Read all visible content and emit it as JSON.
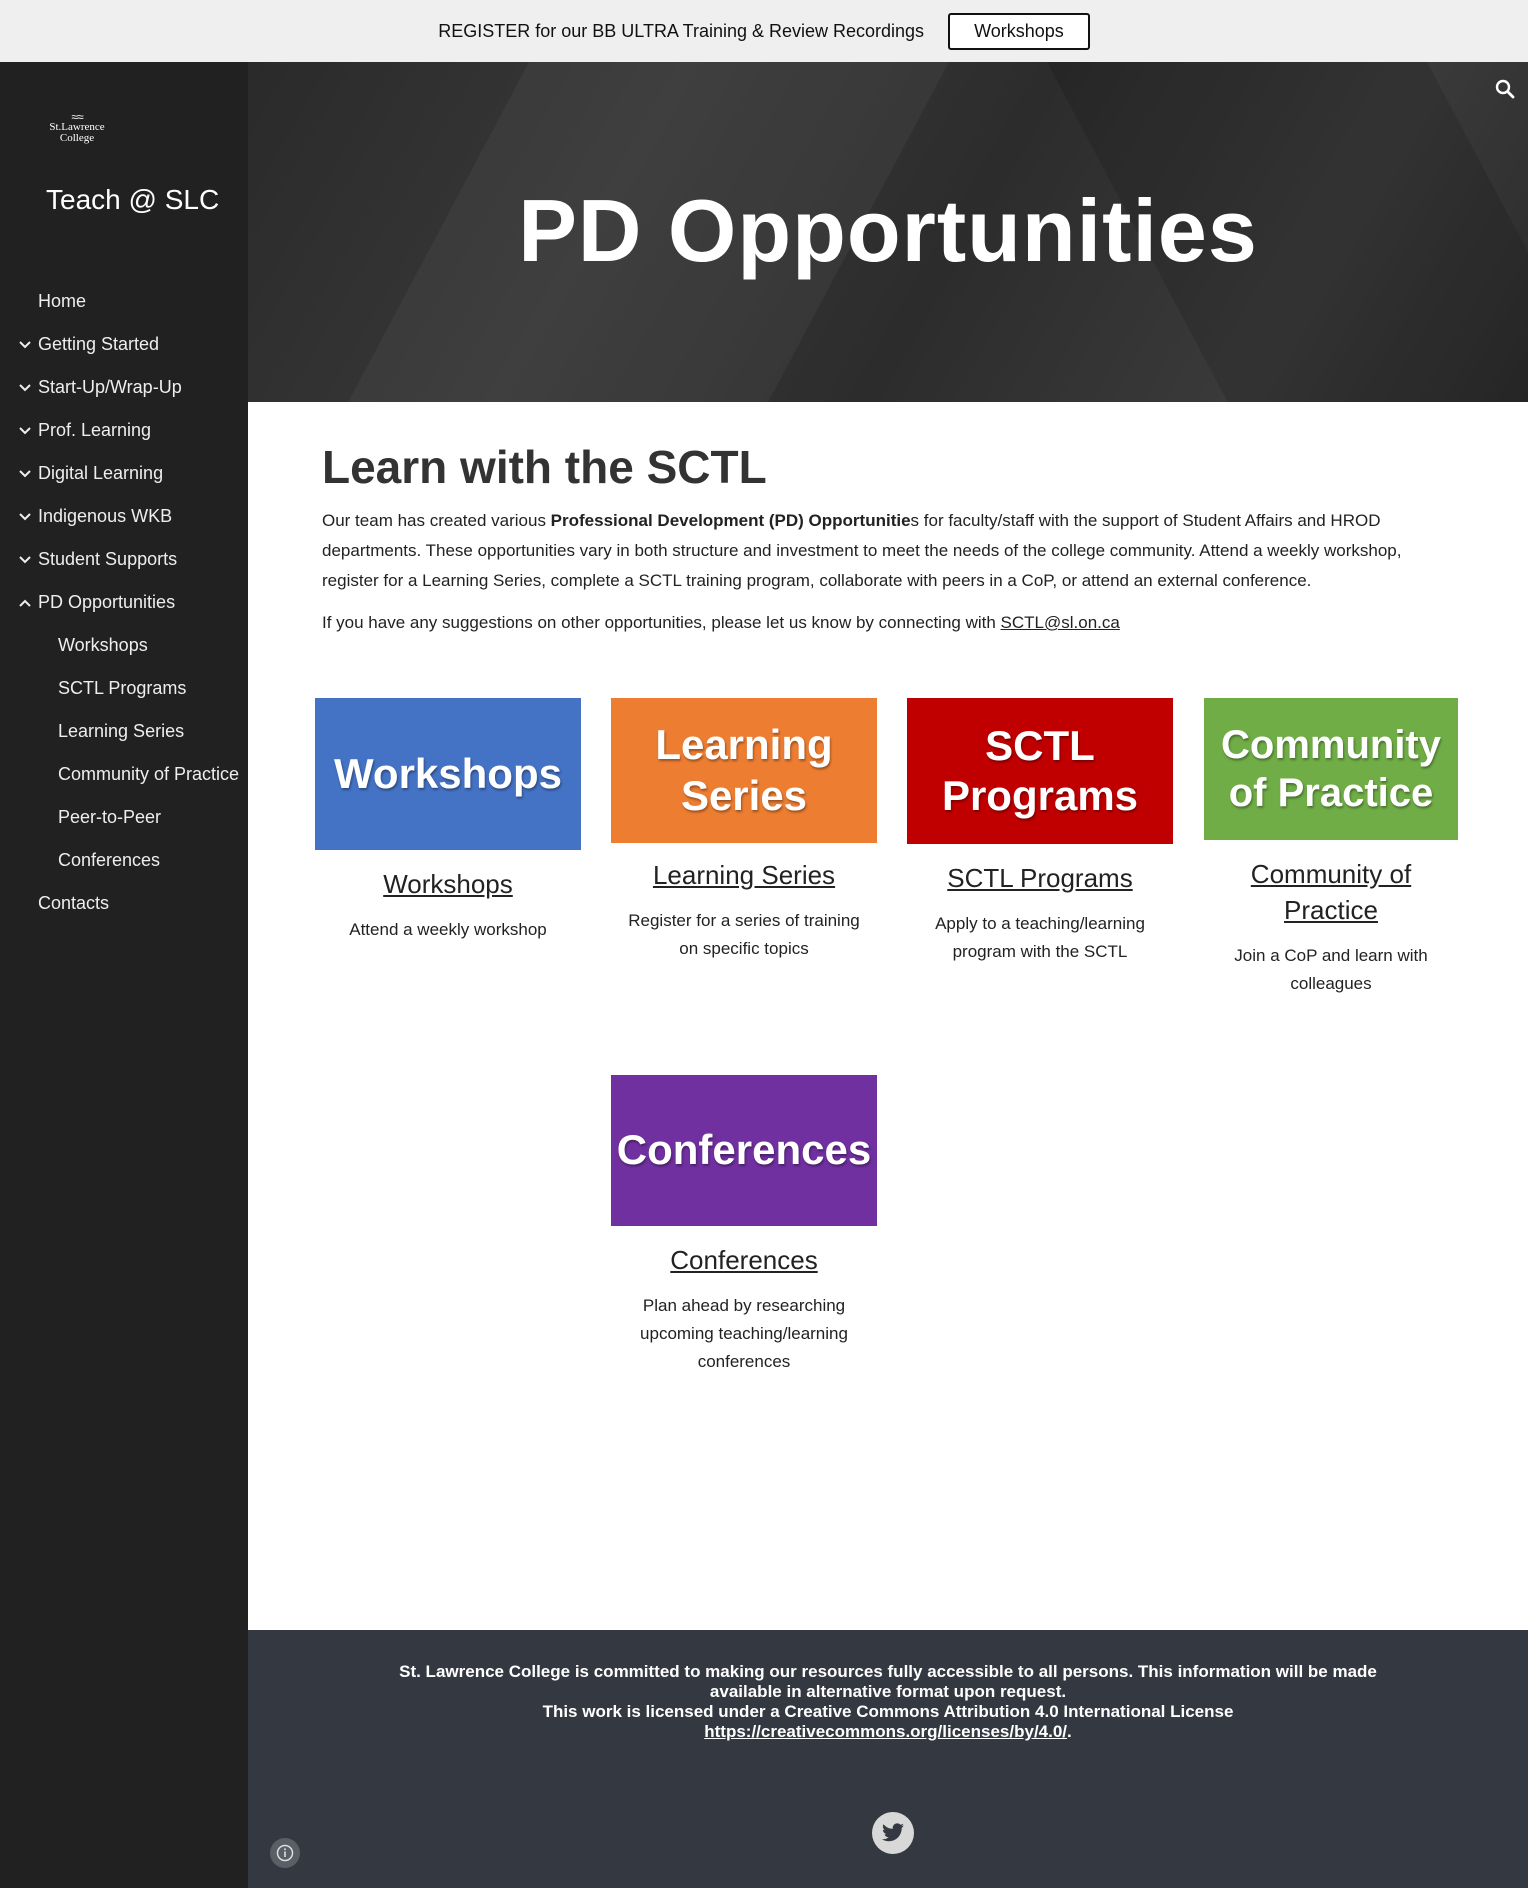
{
  "banner": {
    "text": "REGISTER for our BB ULTRA Training & Review Recordings",
    "button_label": "Workshops"
  },
  "sidebar": {
    "logo_text": "St.Lawrence College",
    "site_title": "Teach @ SLC",
    "items": [
      {
        "label": "Home",
        "level": "top",
        "chevron": ""
      },
      {
        "label": "Getting Started",
        "level": "top",
        "chevron": "down"
      },
      {
        "label": "Start-Up/Wrap-Up",
        "level": "top",
        "chevron": "down"
      },
      {
        "label": "Prof. Learning",
        "level": "top",
        "chevron": "down"
      },
      {
        "label": "Digital Learning",
        "level": "top",
        "chevron": "down"
      },
      {
        "label": "Indigenous WKB",
        "level": "top",
        "chevron": "down"
      },
      {
        "label": "Student Supports",
        "level": "top",
        "chevron": "down"
      },
      {
        "label": "PD Opportunities",
        "level": "top",
        "chevron": "up"
      },
      {
        "label": "Workshops",
        "level": "sub",
        "chevron": ""
      },
      {
        "label": "SCTL Programs",
        "level": "sub",
        "chevron": ""
      },
      {
        "label": "Learning Series",
        "level": "sub",
        "chevron": ""
      },
      {
        "label": "Community of Practice",
        "level": "sub",
        "chevron": ""
      },
      {
        "label": "Peer-to-Peer",
        "level": "sub",
        "chevron": ""
      },
      {
        "label": "Conferences",
        "level": "sub",
        "chevron": ""
      },
      {
        "label": "Contacts",
        "level": "top",
        "chevron": ""
      }
    ]
  },
  "hero": {
    "title": "PD Opportunities"
  },
  "main": {
    "heading": "Learn with the SCTL",
    "intro_before_bold": "Our team has created various ",
    "intro_bold": "Professional Development (PD) Opportunitie",
    "intro_after_bold": "s for faculty/staff with the support of Student Affairs and HROD departments. These opportunities vary in both structure and investment to meet the needs of the college community. Attend a weekly workshop, register for a Learning Series, complete a SCTL training program, collaborate with peers in a CoP, or attend an external conference.",
    "suggest_text": "If you have any suggestions on other opportunities, please let us know by connecting with ",
    "suggest_email": "SCTL@sl.on.ca",
    "cards": [
      {
        "tile_line1": "Workshops",
        "tile_line2": "",
        "color": "#4472c4",
        "link": "Workshops",
        "desc": "Attend a weekly workshop"
      },
      {
        "tile_line1": "Learning",
        "tile_line2": "Series",
        "color": "#ed7d31",
        "link": "Learning Series",
        "desc": "Register for a series of training on specific topics"
      },
      {
        "tile_line1": "SCTL",
        "tile_line2": "Programs",
        "color": "#c00000",
        "link": "SCTL Programs",
        "desc": "Apply to a teaching/learning program with the SCTL"
      },
      {
        "tile_line1": "Community",
        "tile_line2": "of Practice",
        "color": "#70ad47",
        "link": "Community of Practice",
        "desc": "Join a CoP and learn with colleagues"
      },
      {
        "tile_line1": "Conferences",
        "tile_line2": "",
        "color": "#7030a0",
        "link": "Conferences",
        "desc": "Plan ahead by researching upcoming teaching/learning conferences"
      }
    ]
  },
  "footer": {
    "line1": "St. Lawrence College is committed to making our resources fully accessible to all persons.  This information will be made",
    "line2": "available in alternative format upon request.",
    "line3": "This work is licensed under a Creative Commons Attribution 4.0 International License",
    "license_link": "https://creativecommons.org/licenses/by/4.0/",
    "after_link": "."
  }
}
